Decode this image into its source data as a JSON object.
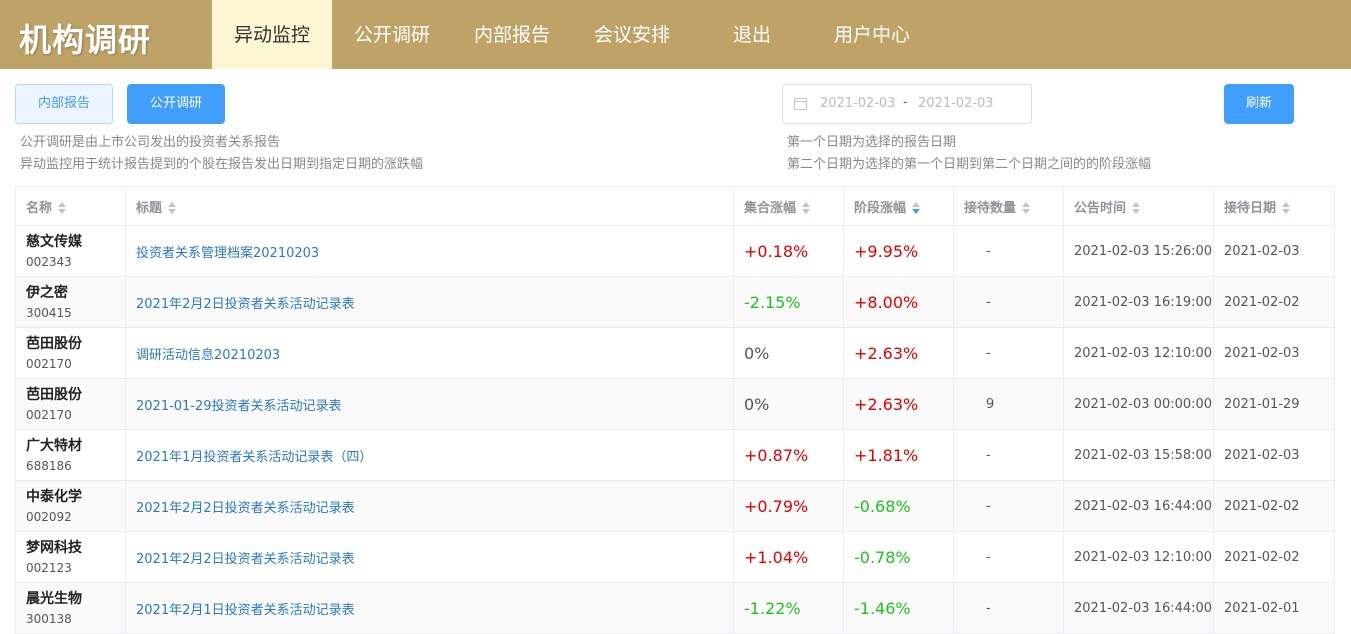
{
  "header": {
    "logo": "机构调研",
    "nav": [
      {
        "label": "异动监控",
        "active": true
      },
      {
        "label": "公开调研",
        "active": false
      },
      {
        "label": "内部报告",
        "active": false
      },
      {
        "label": "会议安排",
        "active": false
      },
      {
        "label": "退出",
        "active": false
      },
      {
        "label": "用户中心",
        "active": false
      }
    ]
  },
  "toolbar": {
    "internal_label": "内部报告",
    "public_label": "公开调研",
    "refresh_label": "刷新",
    "date_start": "2021-02-03",
    "date_sep": "-",
    "date_end": "2021-02-03",
    "notes_left": [
      "公开调研是由上市公司发出的投资者关系报告",
      "异动监控用于统计报告提到的个股在报告发出日期到指定日期的涨跌幅"
    ],
    "notes_right": [
      "第一个日期为选择的报告日期",
      "第二个日期为选择的第一个日期到第二个日期之间的的阶段涨幅"
    ]
  },
  "table": {
    "columns": [
      "名称",
      "标题",
      "集合涨幅",
      "阶段涨幅",
      "接待数量",
      "公告时间",
      "接待日期"
    ],
    "rows": [
      {
        "name": "慈文传媒",
        "code": "002343",
        "title": "投资者关系管理档案20210203",
        "auction": "+0.18%",
        "stage": "+9.95%",
        "count": "-",
        "pub_time": "2021-02-03 15:26:00",
        "date": "2021-02-03"
      },
      {
        "name": "伊之密",
        "code": "300415",
        "title": "2021年2月2日投资者关系活动记录表",
        "auction": "-2.15%",
        "stage": "+8.00%",
        "count": "-",
        "pub_time": "2021-02-03 16:19:00",
        "date": "2021-02-02"
      },
      {
        "name": "芭田股份",
        "code": "002170",
        "title": "调研活动信息20210203",
        "auction": "0%",
        "stage": "+2.63%",
        "count": "-",
        "pub_time": "2021-02-03 12:10:00",
        "date": "2021-02-03"
      },
      {
        "name": "芭田股份",
        "code": "002170",
        "title": "2021-01-29投资者关系活动记录表",
        "auction": "0%",
        "stage": "+2.63%",
        "count": "9",
        "pub_time": "2021-02-03 00:00:00",
        "date": "2021-01-29"
      },
      {
        "name": "广大特材",
        "code": "688186",
        "title": "2021年1月投资者关系活动记录表（四）",
        "auction": "+0.87%",
        "stage": "+1.81%",
        "count": "-",
        "pub_time": "2021-02-03 15:58:00",
        "date": "2021-02-03"
      },
      {
        "name": "中泰化学",
        "code": "002092",
        "title": "2021年2月2日投资者关系活动记录表",
        "auction": "+0.79%",
        "stage": "-0.68%",
        "count": "-",
        "pub_time": "2021-02-03 16:44:00",
        "date": "2021-02-02"
      },
      {
        "name": "梦网科技",
        "code": "002123",
        "title": "2021年2月2日投资者关系活动记录表",
        "auction": "+1.04%",
        "stage": "-0.78%",
        "count": "-",
        "pub_time": "2021-02-03 12:10:00",
        "date": "2021-02-02"
      },
      {
        "name": "晨光生物",
        "code": "300138",
        "title": "2021年2月1日投资者关系活动记录表",
        "auction": "-1.22%",
        "stage": "-1.46%",
        "count": "-",
        "pub_time": "2021-02-03 16:44:00",
        "date": "2021-02-01"
      }
    ]
  },
  "colors": {
    "header_bg": "#bfa366",
    "active_tab_bg": "#fdf6d3",
    "primary": "#409eff",
    "up": "#e60000",
    "down": "#1bc41b",
    "link": "#2b78c5"
  },
  "icons": {
    "date": "calendar-icon",
    "sort": "sort-caret-icon"
  }
}
